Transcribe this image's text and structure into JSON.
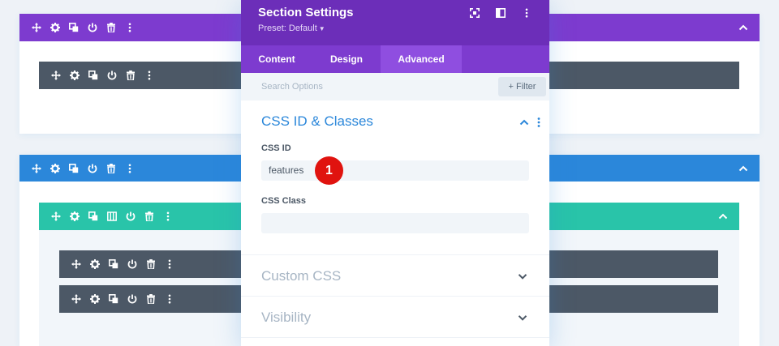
{
  "colors": {
    "section_purple": "#7d3bcf",
    "section_blue": "#2b87da",
    "row_teal": "#29c4a9",
    "module_gray": "#4c5866",
    "modal_header": "#6c2eb9",
    "tab_active": "#8f4ee0",
    "badge": "#e0130f"
  },
  "modal": {
    "title": "Section Settings",
    "preset": "Preset: Default",
    "header_icons": [
      "fullscreen-icon",
      "split-view-icon",
      "more-vertical-icon"
    ],
    "tabs": [
      {
        "label": "Content",
        "active": false
      },
      {
        "label": "Design",
        "active": false
      },
      {
        "label": "Advanced",
        "active": true
      }
    ],
    "search": {
      "placeholder": "Search Options"
    },
    "filter_label": "+ Filter",
    "groups": {
      "css": {
        "title": "CSS ID & Classes",
        "expanded": true,
        "css_id_label": "CSS ID",
        "css_id_value": "features",
        "css_class_label": "CSS Class",
        "css_class_value": ""
      },
      "custom_css": {
        "title": "Custom CSS",
        "expanded": false
      },
      "visibility": {
        "title": "Visibility",
        "expanded": false
      }
    }
  },
  "annotation": {
    "badge": "1"
  },
  "builder": {
    "section_icons": [
      "move-icon",
      "gear-icon",
      "duplicate-icon",
      "power-icon",
      "trash-icon",
      "more-vertical-icon"
    ],
    "row_icons": [
      "move-icon",
      "gear-icon",
      "duplicate-icon",
      "columns-icon",
      "power-icon",
      "trash-icon",
      "more-vertical-icon"
    ],
    "module_icons": [
      "move-icon",
      "gear-icon",
      "duplicate-icon",
      "power-icon",
      "trash-icon",
      "more-vertical-icon"
    ]
  }
}
